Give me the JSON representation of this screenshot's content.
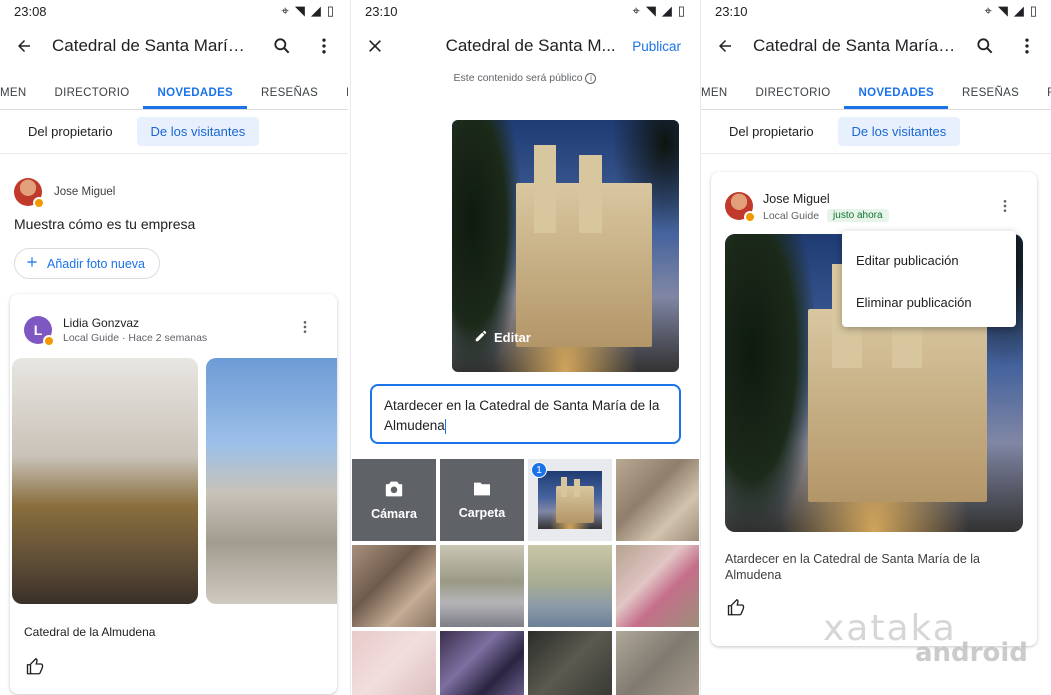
{
  "screen1": {
    "status_time": "23:08",
    "title": "Catedral de Santa María l...",
    "tabs": [
      "MEN",
      "DIRECTORIO",
      "NOVEDADES",
      "RESEÑAS",
      "FOTOS"
    ],
    "chips": [
      "Del propietario",
      "De los visitantes"
    ],
    "owner_name": "Jose Miguel",
    "prompt": "Muestra cómo es tu empresa",
    "add_photo_label": "Añadir foto nueva",
    "post": {
      "avatar_letter": "L",
      "author": "Lidia Gonzvaz",
      "meta": "Local Guide · Hace 2 semanas",
      "caption": "Catedral de la Almudena"
    }
  },
  "screen2": {
    "status_time": "23:10",
    "title": "Catedral de Santa M...",
    "publish_label": "Publicar",
    "public_notice": "Este contenido será público",
    "edit_label": "Editar",
    "caption_value": "Atardecer en la Catedral de Santa María de la Almudena",
    "camera_label": "Cámara",
    "folder_label": "Carpeta",
    "selected_count": "1"
  },
  "screen3": {
    "status_time": "23:10",
    "title": "Catedral de Santa María l...",
    "tabs": [
      "MEN",
      "DIRECTORIO",
      "NOVEDADES",
      "RESEÑAS",
      "FOTOS"
    ],
    "chips": [
      "Del propietario",
      "De los visitantes"
    ],
    "post": {
      "author": "Jose Miguel",
      "meta": "Local Guide",
      "badge": "justo ahora",
      "caption": "Atardecer en la Catedral de Santa María de la Almudena"
    },
    "menu": [
      "Editar publicación",
      "Eliminar publicación"
    ]
  },
  "watermark": {
    "line1": "xataka",
    "line2": "android"
  },
  "colors": {
    "accent": "#1a73e8",
    "chip_bg": "#e8f0fe",
    "avatar_purple": "#7e57c2",
    "badge_green_bg": "#e6f4ea",
    "badge_green_text": "#137333"
  },
  "icons": [
    "back-arrow-icon",
    "search-icon",
    "more-vert-icon",
    "close-icon",
    "info-icon",
    "pencil-icon",
    "camera-icon",
    "folder-icon",
    "plus-icon",
    "thumb-up-icon"
  ]
}
